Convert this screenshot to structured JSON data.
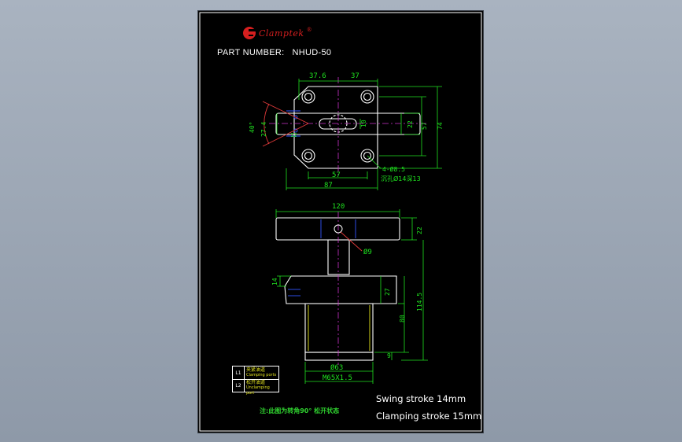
{
  "brand": {
    "name": "Clamptek",
    "mark": "®",
    "color": "#d61f1f"
  },
  "part": {
    "label": "PART NUMBER:",
    "value": "NHUD-50"
  },
  "dimensions": {
    "top_left_width": "37.6",
    "top_right_width": "37",
    "angle": "40°",
    "left_offset": "27.4",
    "bore": "10",
    "height_inner": "22",
    "height_mid": "57",
    "height_total": "74",
    "slot_label": "12",
    "hole_spacing": "57",
    "overall_width": "87",
    "holes": "4-Ø8.5",
    "counterbore": "沉孔Ø14深13",
    "arm_length": "120",
    "arm_height": "22",
    "pin": "Ø9",
    "flange_thickness": "14",
    "flange_to_body": "27",
    "body_height": "80",
    "total_height": "114.5",
    "base_step": "9",
    "body_dia": "Ø63",
    "thread": "M65X1.5"
  },
  "legend": [
    {
      "tag": "L1",
      "cn": "夹紧油道",
      "en": "Clamping ports"
    },
    {
      "tag": "L2",
      "cn": "松开油道",
      "en": "Unclamping port"
    }
  ],
  "note": "注:此图为转角90° 松开状态",
  "specs": {
    "swing": "Swing stroke 14mm",
    "clamping": "Clamping stroke 15mm"
  },
  "colors": {
    "outline": "#ffffff",
    "dimension": "#1fe21f",
    "center_line": "#cc33cc",
    "hidden_line": "#3355ff",
    "callout": "#e03a3a",
    "thread_line": "#e6e61a"
  }
}
